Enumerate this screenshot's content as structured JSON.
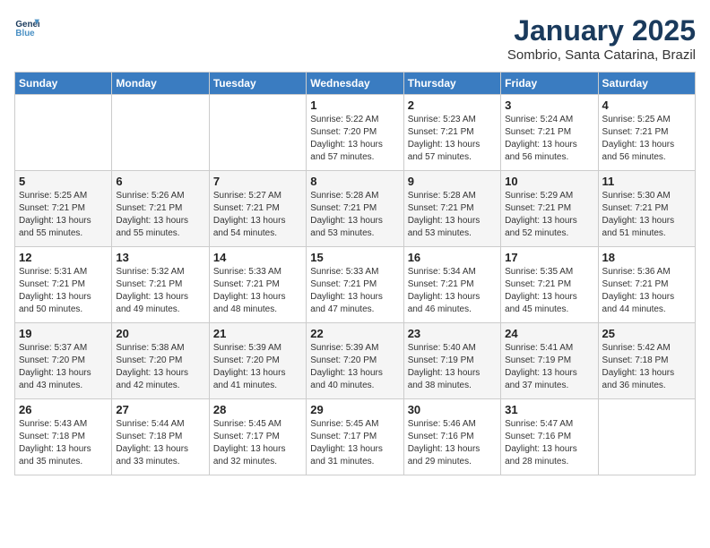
{
  "logo": {
    "line1": "General",
    "line2": "Blue"
  },
  "title": "January 2025",
  "subtitle": "Sombrio, Santa Catarina, Brazil",
  "days_of_week": [
    "Sunday",
    "Monday",
    "Tuesday",
    "Wednesday",
    "Thursday",
    "Friday",
    "Saturday"
  ],
  "weeks": [
    [
      {
        "day": "",
        "content": ""
      },
      {
        "day": "",
        "content": ""
      },
      {
        "day": "",
        "content": ""
      },
      {
        "day": "1",
        "content": "Sunrise: 5:22 AM\nSunset: 7:20 PM\nDaylight: 13 hours\nand 57 minutes."
      },
      {
        "day": "2",
        "content": "Sunrise: 5:23 AM\nSunset: 7:21 PM\nDaylight: 13 hours\nand 57 minutes."
      },
      {
        "day": "3",
        "content": "Sunrise: 5:24 AM\nSunset: 7:21 PM\nDaylight: 13 hours\nand 56 minutes."
      },
      {
        "day": "4",
        "content": "Sunrise: 5:25 AM\nSunset: 7:21 PM\nDaylight: 13 hours\nand 56 minutes."
      }
    ],
    [
      {
        "day": "5",
        "content": "Sunrise: 5:25 AM\nSunset: 7:21 PM\nDaylight: 13 hours\nand 55 minutes."
      },
      {
        "day": "6",
        "content": "Sunrise: 5:26 AM\nSunset: 7:21 PM\nDaylight: 13 hours\nand 55 minutes."
      },
      {
        "day": "7",
        "content": "Sunrise: 5:27 AM\nSunset: 7:21 PM\nDaylight: 13 hours\nand 54 minutes."
      },
      {
        "day": "8",
        "content": "Sunrise: 5:28 AM\nSunset: 7:21 PM\nDaylight: 13 hours\nand 53 minutes."
      },
      {
        "day": "9",
        "content": "Sunrise: 5:28 AM\nSunset: 7:21 PM\nDaylight: 13 hours\nand 53 minutes."
      },
      {
        "day": "10",
        "content": "Sunrise: 5:29 AM\nSunset: 7:21 PM\nDaylight: 13 hours\nand 52 minutes."
      },
      {
        "day": "11",
        "content": "Sunrise: 5:30 AM\nSunset: 7:21 PM\nDaylight: 13 hours\nand 51 minutes."
      }
    ],
    [
      {
        "day": "12",
        "content": "Sunrise: 5:31 AM\nSunset: 7:21 PM\nDaylight: 13 hours\nand 50 minutes."
      },
      {
        "day": "13",
        "content": "Sunrise: 5:32 AM\nSunset: 7:21 PM\nDaylight: 13 hours\nand 49 minutes."
      },
      {
        "day": "14",
        "content": "Sunrise: 5:33 AM\nSunset: 7:21 PM\nDaylight: 13 hours\nand 48 minutes."
      },
      {
        "day": "15",
        "content": "Sunrise: 5:33 AM\nSunset: 7:21 PM\nDaylight: 13 hours\nand 47 minutes."
      },
      {
        "day": "16",
        "content": "Sunrise: 5:34 AM\nSunset: 7:21 PM\nDaylight: 13 hours\nand 46 minutes."
      },
      {
        "day": "17",
        "content": "Sunrise: 5:35 AM\nSunset: 7:21 PM\nDaylight: 13 hours\nand 45 minutes."
      },
      {
        "day": "18",
        "content": "Sunrise: 5:36 AM\nSunset: 7:21 PM\nDaylight: 13 hours\nand 44 minutes."
      }
    ],
    [
      {
        "day": "19",
        "content": "Sunrise: 5:37 AM\nSunset: 7:20 PM\nDaylight: 13 hours\nand 43 minutes."
      },
      {
        "day": "20",
        "content": "Sunrise: 5:38 AM\nSunset: 7:20 PM\nDaylight: 13 hours\nand 42 minutes."
      },
      {
        "day": "21",
        "content": "Sunrise: 5:39 AM\nSunset: 7:20 PM\nDaylight: 13 hours\nand 41 minutes."
      },
      {
        "day": "22",
        "content": "Sunrise: 5:39 AM\nSunset: 7:20 PM\nDaylight: 13 hours\nand 40 minutes."
      },
      {
        "day": "23",
        "content": "Sunrise: 5:40 AM\nSunset: 7:19 PM\nDaylight: 13 hours\nand 38 minutes."
      },
      {
        "day": "24",
        "content": "Sunrise: 5:41 AM\nSunset: 7:19 PM\nDaylight: 13 hours\nand 37 minutes."
      },
      {
        "day": "25",
        "content": "Sunrise: 5:42 AM\nSunset: 7:18 PM\nDaylight: 13 hours\nand 36 minutes."
      }
    ],
    [
      {
        "day": "26",
        "content": "Sunrise: 5:43 AM\nSunset: 7:18 PM\nDaylight: 13 hours\nand 35 minutes."
      },
      {
        "day": "27",
        "content": "Sunrise: 5:44 AM\nSunset: 7:18 PM\nDaylight: 13 hours\nand 33 minutes."
      },
      {
        "day": "28",
        "content": "Sunrise: 5:45 AM\nSunset: 7:17 PM\nDaylight: 13 hours\nand 32 minutes."
      },
      {
        "day": "29",
        "content": "Sunrise: 5:45 AM\nSunset: 7:17 PM\nDaylight: 13 hours\nand 31 minutes."
      },
      {
        "day": "30",
        "content": "Sunrise: 5:46 AM\nSunset: 7:16 PM\nDaylight: 13 hours\nand 29 minutes."
      },
      {
        "day": "31",
        "content": "Sunrise: 5:47 AM\nSunset: 7:16 PM\nDaylight: 13 hours\nand 28 minutes."
      },
      {
        "day": "",
        "content": ""
      }
    ]
  ]
}
